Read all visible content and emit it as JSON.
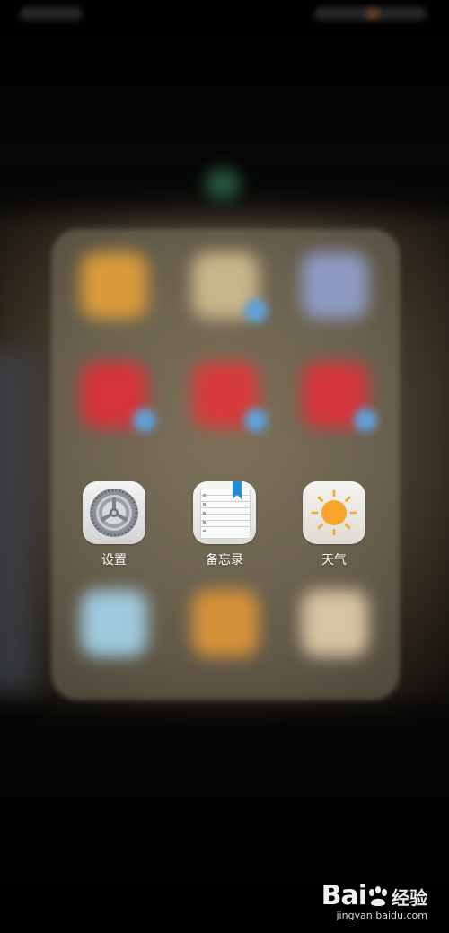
{
  "folder": {
    "apps": [
      {
        "label": "设置",
        "icon": "settings-gear-icon"
      },
      {
        "label": "备忘录",
        "icon": "memo-notepad-icon"
      },
      {
        "label": "天气",
        "icon": "weather-sun-icon"
      }
    ]
  },
  "watermark": {
    "logo_left": "Bai",
    "logo_right": "经验",
    "url": "jingyan.baidu.com"
  },
  "colors": {
    "sun": "#f6a52a",
    "memo_bookmark": "#1f8fd8"
  }
}
